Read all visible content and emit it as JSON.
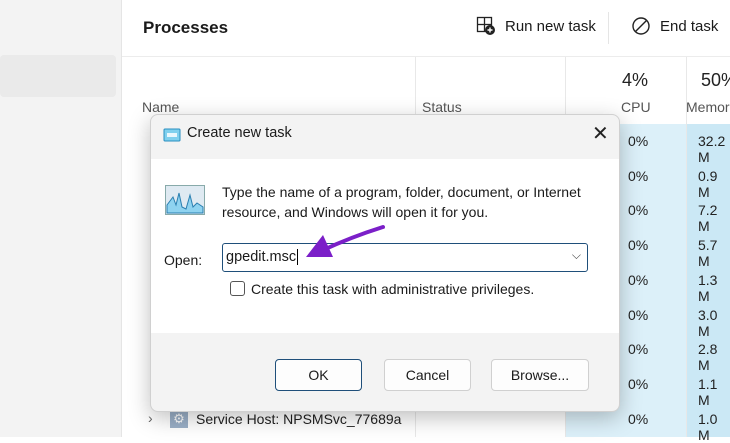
{
  "header": {
    "title": "Processes",
    "run_new_task": "Run new task",
    "end_task": "End task"
  },
  "columns": {
    "name": "Name",
    "status": "Status",
    "cpu_pct": "4%",
    "cpu": "CPU",
    "mem_pct": "50%",
    "mem": "Memor"
  },
  "rows": [
    {
      "name": "",
      "cpu": "0%",
      "mem": "32.2 M"
    },
    {
      "name": "",
      "cpu": "0%",
      "mem": "0.9 M"
    },
    {
      "name": "",
      "cpu": "0%",
      "mem": "7.2 M"
    },
    {
      "name": "",
      "cpu": "0%",
      "mem": "5.7 M"
    },
    {
      "name": "",
      "cpu": "0%",
      "mem": "1.3 M"
    },
    {
      "name": "",
      "cpu": "0%",
      "mem": "3.0 M"
    },
    {
      "name": "",
      "cpu": "0%",
      "mem": "2.8 M"
    },
    {
      "name": "",
      "cpu": "0%",
      "mem": "1.1 M"
    },
    {
      "name": "Service Host: NPSMSvc_77689a",
      "cpu": "0%",
      "mem": "1.0 M"
    }
  ],
  "dialog": {
    "title": "Create new task",
    "description": "Type the name of a program, folder, document, or Internet resource, and Windows will open it for you.",
    "open_label": "Open:",
    "open_value": "gpedit.msc",
    "admin_checkbox": "Create this task with administrative privileges.",
    "admin_checked": false,
    "ok": "OK",
    "cancel": "Cancel",
    "browse": "Browse..."
  },
  "colors": {
    "accent": "#005fb8",
    "arrow": "#7b1fc8",
    "cpu_bg": "#dcf0f9",
    "mem_bg": "#cbe8f5"
  }
}
